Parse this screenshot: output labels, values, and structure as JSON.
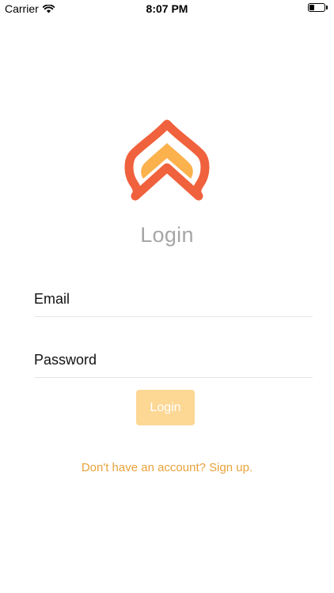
{
  "status_bar": {
    "carrier": "Carrier",
    "time": "8:07 PM",
    "battery_level": 0.35,
    "icons": [
      "wifi-icon",
      "battery-icon"
    ]
  },
  "login": {
    "title": "Login",
    "email_placeholder": "Email",
    "password_placeholder": "Password",
    "button_label": "Login",
    "signup_text": "Don't have an account? Sign up."
  },
  "colors": {
    "logo_outer": "#f0613d",
    "logo_inner": "#fbb24d",
    "button_bg": "#fdd794",
    "link": "#e8a33a",
    "title": "#a6a6a6"
  }
}
